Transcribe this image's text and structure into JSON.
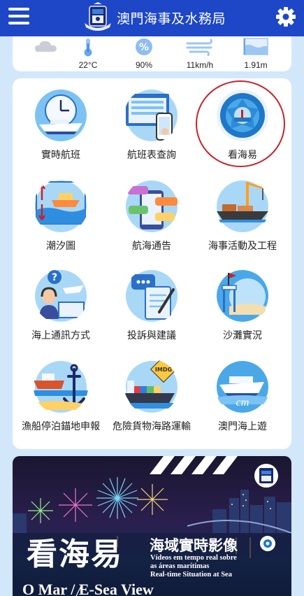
{
  "header": {
    "title": "澳門海事及水務局",
    "menu_icon": "hamburger-menu-icon",
    "settings_icon": "gear-icon",
    "logo": "dsamsa-logo"
  },
  "weather": [
    {
      "icon": "cloud-icon",
      "value": ""
    },
    {
      "icon": "thermometer-icon",
      "value": "22°C"
    },
    {
      "icon": "humidity-percent-icon",
      "value": "90%"
    },
    {
      "icon": "wind-icon",
      "value": "11km/h"
    },
    {
      "icon": "tide-level-icon",
      "value": "1.91m"
    }
  ],
  "services": [
    {
      "label": "實時航班",
      "icon": "ferry-clock-icon"
    },
    {
      "label": "航班表查詢",
      "icon": "timetable-phone-icon"
    },
    {
      "label": "看海易",
      "icon": "camera-lens-icon"
    },
    {
      "label": "潮汐圖",
      "icon": "tide-chart-icon"
    },
    {
      "label": "航海通告",
      "icon": "notice-phone-icon"
    },
    {
      "label": "海事活動及工程",
      "icon": "crane-ship-icon"
    },
    {
      "label": "海上通訊方式",
      "icon": "operator-icon"
    },
    {
      "label": "投訴與建議",
      "icon": "complaint-note-icon"
    },
    {
      "label": "沙灘實況",
      "icon": "beach-tower-icon"
    },
    {
      "label": "漁船停泊錨地申報",
      "icon": "fishing-boat-anchor-icon"
    },
    {
      "label": "危險貨物海路運輸",
      "icon": "cargo-ship-imdg-icon"
    },
    {
      "label": "澳門海上遊",
      "icon": "cruise-ship-icon"
    }
  ],
  "banner": {
    "title": "看海易",
    "live_title": "海域實時影像",
    "pt_line1": "Vídeos em tempo real sobre",
    "pt_line2": "as áreas marítimas",
    "en_line": "Real-time Situation at Sea",
    "footer": "O Mar / E-Sea View",
    "imdg": "IMDG"
  },
  "colors": {
    "header_bg": "#1d47c6",
    "page_bg": "#d3e7fb",
    "highlight": "#c8222a"
  }
}
